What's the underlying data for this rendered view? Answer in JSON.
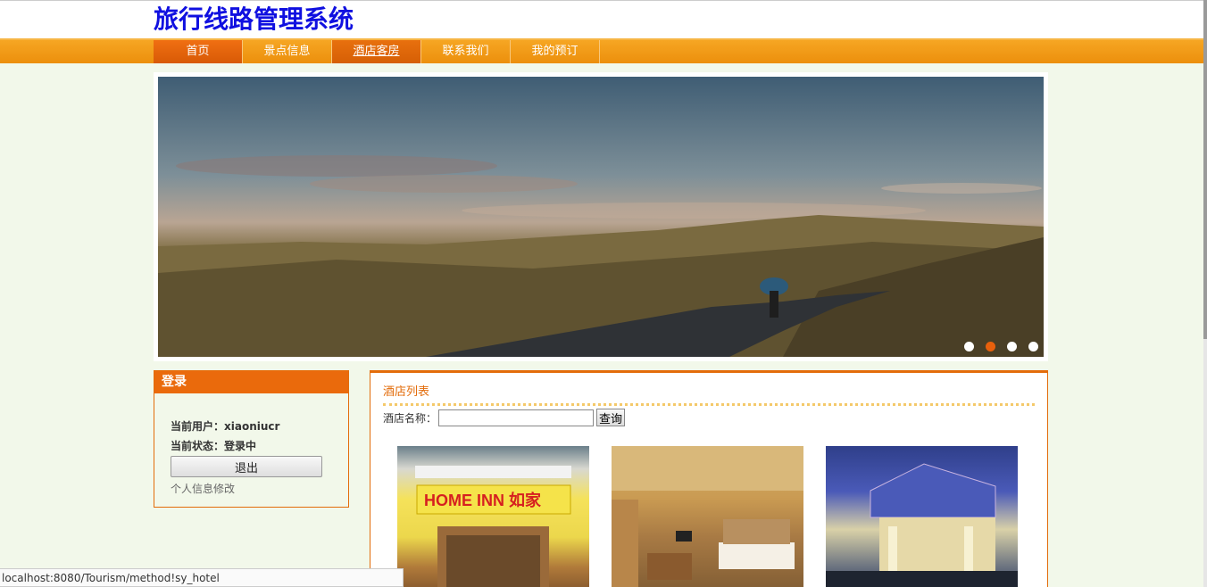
{
  "header": {
    "title": "旅行线路管理系统"
  },
  "nav": {
    "items": [
      {
        "label": "首页"
      },
      {
        "label": "景点信息"
      },
      {
        "label": "酒店客房"
      },
      {
        "label": "联系我们"
      },
      {
        "label": "我的预订"
      }
    ]
  },
  "banner": {
    "slide_count": 4,
    "active_slide": 2
  },
  "login": {
    "title": "登录",
    "user_line": "当前用户：xiaoniucr",
    "status_line": "当前状态：登录中",
    "logout_label": "退出",
    "profile_link": "个人信息修改"
  },
  "hotels": {
    "title": "酒店列表",
    "search_label": "酒店名称：",
    "search_value": "",
    "search_button": "查询",
    "card1_sign": "HOME INN 如家"
  },
  "status_bar": {
    "url": "localhost:8080/Tourism/method!sy_hotel"
  },
  "colors": {
    "accent": "#e36c0a",
    "nav": "#f29a12",
    "title": "#1010e0",
    "page_bg": "#f2f8ea"
  }
}
